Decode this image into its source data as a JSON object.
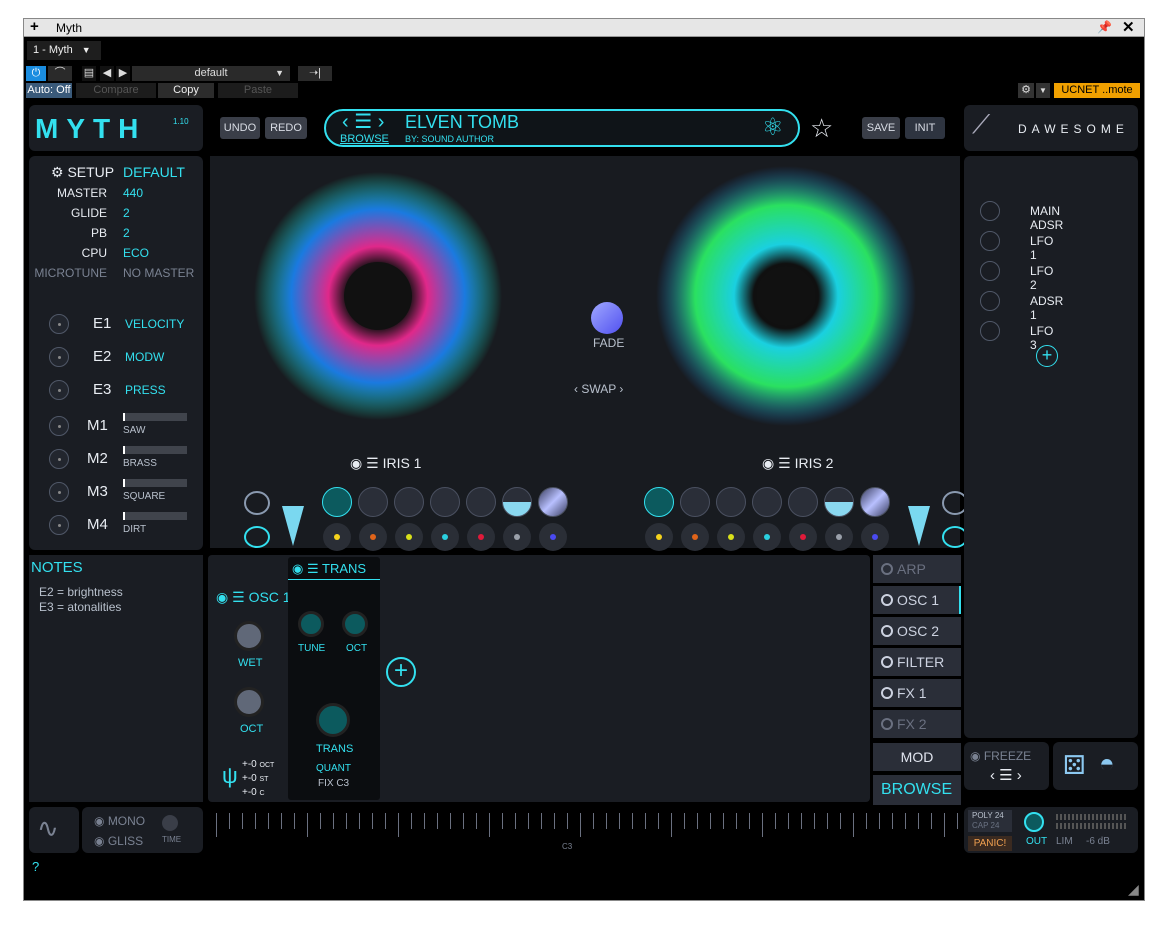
{
  "window": {
    "title": "Myth"
  },
  "host": {
    "preset_tab": "1 - Myth",
    "preset_name": "default",
    "auto": "Auto: Off",
    "compare": "Compare",
    "copy": "Copy",
    "paste": "Paste",
    "ucnet": "UCNET ..mote"
  },
  "logo": {
    "name": "MYTH",
    "version": "1.10"
  },
  "toolbar": {
    "undo": "UNDO",
    "redo": "REDO",
    "save": "SAVE",
    "init": "INIT"
  },
  "browser": {
    "preset": "ELVEN TOMB",
    "author": "BY: SOUND AUTHOR",
    "browse": "BROWSE"
  },
  "brand": "DAWESOME",
  "setup": {
    "title": "SETUP",
    "value": "DEFAULT",
    "rows": [
      {
        "label": "MASTER",
        "value": "440"
      },
      {
        "label": "GLIDE",
        "value": "2"
      },
      {
        "label": "PB",
        "value": "2"
      },
      {
        "label": "CPU",
        "value": "ECO"
      },
      {
        "label": "MICROTUNE",
        "value": "NO MASTER"
      }
    ]
  },
  "expressions": [
    {
      "id": "E1",
      "value": "VELOCITY"
    },
    {
      "id": "E2",
      "value": "MODW"
    },
    {
      "id": "E3",
      "value": "PRESS"
    }
  ],
  "macros": [
    {
      "id": "M1",
      "name": "SAW",
      "level": 0.02
    },
    {
      "id": "M2",
      "name": "BRASS",
      "level": 0.02
    },
    {
      "id": "M3",
      "name": "SQUARE",
      "level": 0.02
    },
    {
      "id": "M4",
      "name": "DIRT",
      "level": 0.02
    }
  ],
  "notes": {
    "title": "NOTES",
    "line1": "E2 = brightness",
    "line2": "E3 = atonalities"
  },
  "center": {
    "fade": "FADE",
    "swap": "SWAP",
    "iris1": "IRIS 1",
    "iris2": "IRIS 2"
  },
  "modulators": [
    {
      "label": "MAIN ADSR"
    },
    {
      "label": "LFO 1"
    },
    {
      "label": "LFO 2"
    },
    {
      "label": "ADSR 1"
    },
    {
      "label": "LFO 3"
    }
  ],
  "osc": {
    "title": "OSC 1",
    "wet": "WET",
    "oct": "OCT",
    "tune_lines": [
      "+-0",
      "+-0",
      "+-0"
    ],
    "tune_units": [
      "OCT",
      "ST",
      "C"
    ]
  },
  "trans": {
    "title": "TRANS",
    "tune": "TUNE",
    "oct": "OCT",
    "trans": "TRANS",
    "quant": "QUANT",
    "fix": "FIX C3"
  },
  "tabs": [
    {
      "label": "ARP",
      "enabled": false
    },
    {
      "label": "OSC 1",
      "enabled": true
    },
    {
      "label": "OSC 2",
      "enabled": true
    },
    {
      "label": "FILTER",
      "enabled": true
    },
    {
      "label": "FX 1",
      "enabled": true
    },
    {
      "label": "FX 2",
      "enabled": false
    }
  ],
  "mod_button": "MOD",
  "browse_button": "BROWSE",
  "freeze": "FREEZE",
  "bottom": {
    "mono": "MONO",
    "gliss": "GLISS",
    "time": "TIME",
    "key_label": "C3",
    "poly": "POLY 24",
    "cap": "CAP 24",
    "panic": "PANIC!",
    "out": "OUT",
    "lim": "LIM",
    "db": "-6 dB",
    "help": "?"
  },
  "dot_colors": [
    "#f6d31c",
    "#e0641a",
    "#d8e01a",
    "#2ad0e0",
    "#e01a3a",
    "#9aa0aa",
    "#4a4af0"
  ]
}
